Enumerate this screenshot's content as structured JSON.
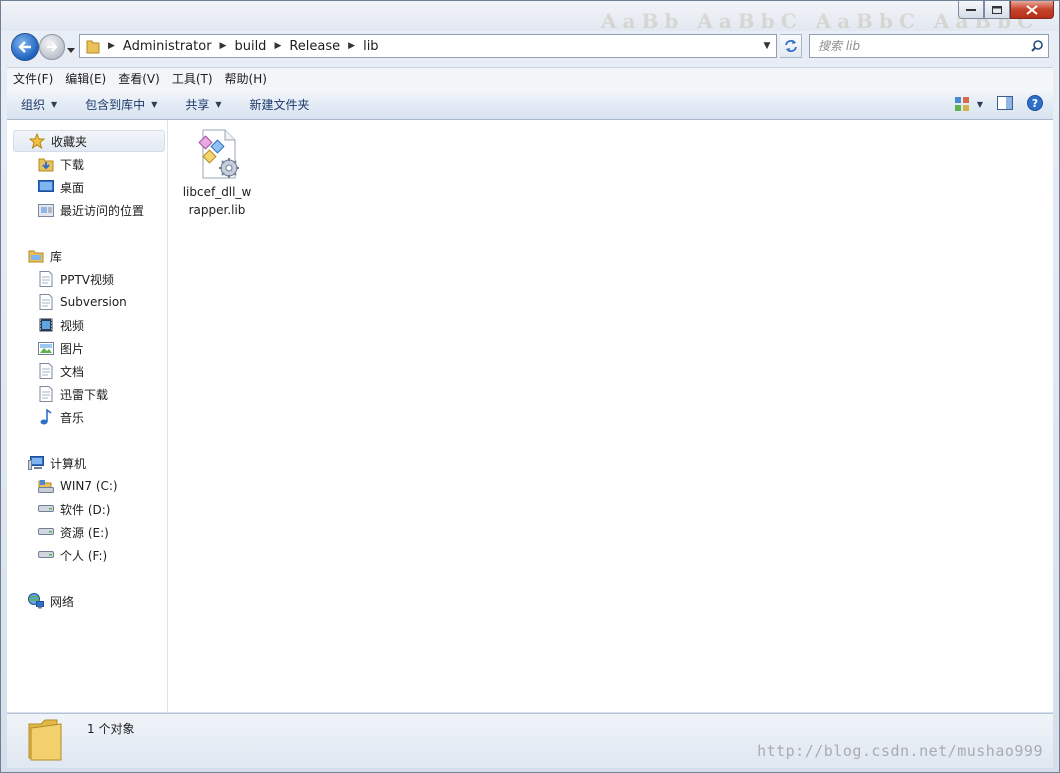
{
  "window": {
    "ghost_title": "AaBb AaBbC AaBbC AaBbC"
  },
  "address": {
    "crumbs": [
      "Administrator",
      "build",
      "Release",
      "lib"
    ]
  },
  "search": {
    "placeholder": "搜索 lib"
  },
  "menu": [
    "文件(F)",
    "编辑(E)",
    "查看(V)",
    "工具(T)",
    "帮助(H)"
  ],
  "commands": {
    "organize": "组织",
    "include_library": "包含到库中",
    "share": "共享",
    "new_folder": "新建文件夹"
  },
  "nav": {
    "favorites": {
      "label": "收藏夹",
      "items": [
        "下载",
        "桌面",
        "最近访问的位置"
      ]
    },
    "libraries": {
      "label": "库",
      "items": [
        "PPTV视频",
        "Subversion",
        "视频",
        "图片",
        "文档",
        "迅雷下载",
        "音乐"
      ]
    },
    "computer": {
      "label": "计算机",
      "items": [
        "WIN7 (C:)",
        "软件 (D:)",
        "资源 (E:)",
        "个人 (F:)"
      ]
    },
    "network": {
      "label": "网络"
    }
  },
  "files": [
    {
      "name": "libcef_dll_wrapper.lib",
      "icon": "lib-file-icon"
    }
  ],
  "status": {
    "count": "1 个对象"
  },
  "watermark": "http://blog.csdn.net/mushao999",
  "colors": {
    "accent": "#1e62bf",
    "close": "#c6422a"
  }
}
